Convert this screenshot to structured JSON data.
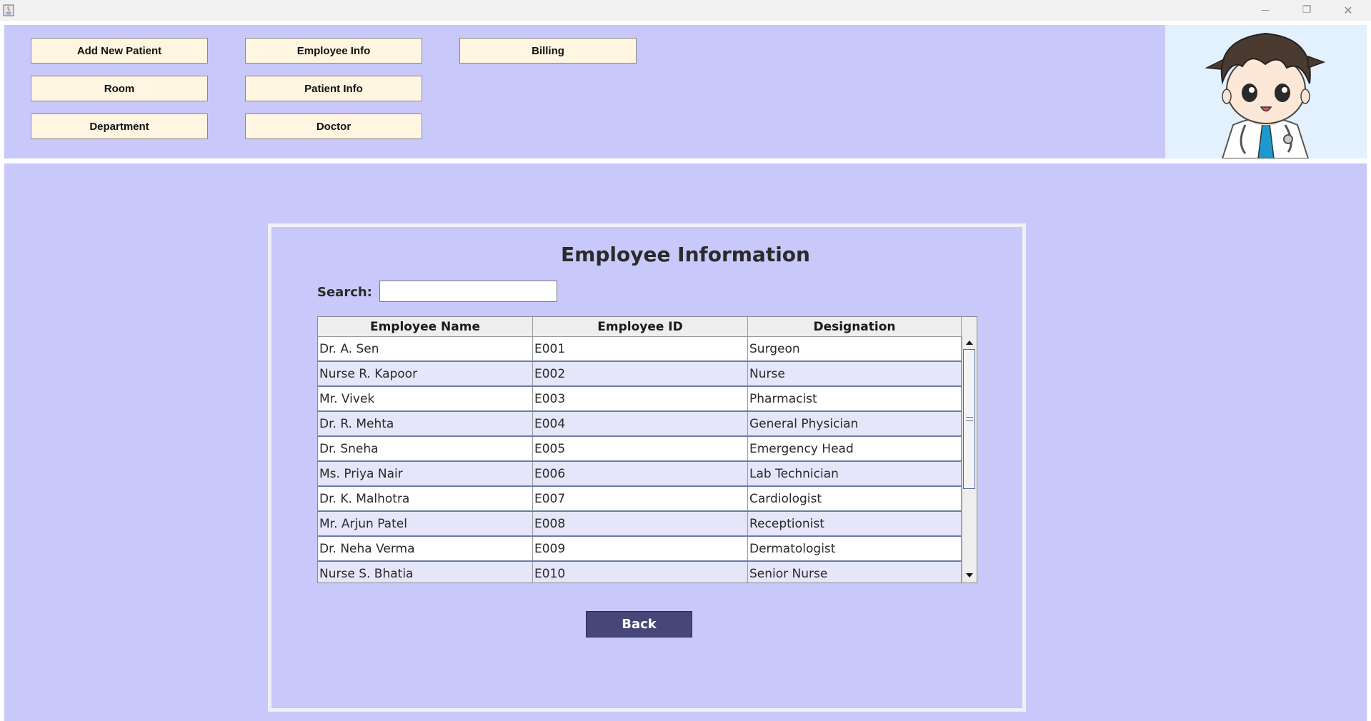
{
  "window": {
    "minimize_glyph": "—",
    "maximize_glyph": "❐",
    "close_glyph": "✕"
  },
  "nav": {
    "add_new_patient": "Add New Patient",
    "employee_info": "Employee Info",
    "billing": "Billing",
    "room": "Room",
    "patient_info": "Patient Info",
    "department": "Department",
    "doctor": "Doctor"
  },
  "main": {
    "title": "Employee Information",
    "search_label": "Search:",
    "search_value": "",
    "back_label": "Back"
  },
  "table": {
    "headers": [
      "Employee Name",
      "Employee ID",
      "Designation"
    ],
    "rows": [
      [
        "Dr. A. Sen",
        "E001",
        "Surgeon"
      ],
      [
        "Nurse R. Kapoor",
        "E002",
        "Nurse"
      ],
      [
        "Mr. Vivek",
        "E003",
        "Pharmacist"
      ],
      [
        "Dr. R. Mehta",
        "E004",
        "General Physician"
      ],
      [
        "Dr. Sneha",
        "E005",
        "Emergency Head"
      ],
      [
        "Ms. Priya Nair",
        "E006",
        "Lab Technician"
      ],
      [
        "Dr. K. Malhotra",
        "E007",
        "Cardiologist"
      ],
      [
        "Mr. Arjun Patel",
        "E008",
        "Receptionist"
      ],
      [
        "Dr. Neha Verma",
        "E009",
        "Dermatologist"
      ],
      [
        "Nurse S. Bhatia",
        "E010",
        "Senior Nurse"
      ]
    ]
  },
  "colors": {
    "panel_bg": "#c8c8fa",
    "nav_button_bg": "#fff5e1",
    "back_button_bg": "#464678",
    "row_alt_bg": "#e6e6fa"
  },
  "icons": {
    "app": "java-app-icon",
    "avatar": "doctor-avatar-illustration",
    "scroll_up": "arrow-up-icon",
    "scroll_down": "arrow-down-icon"
  }
}
